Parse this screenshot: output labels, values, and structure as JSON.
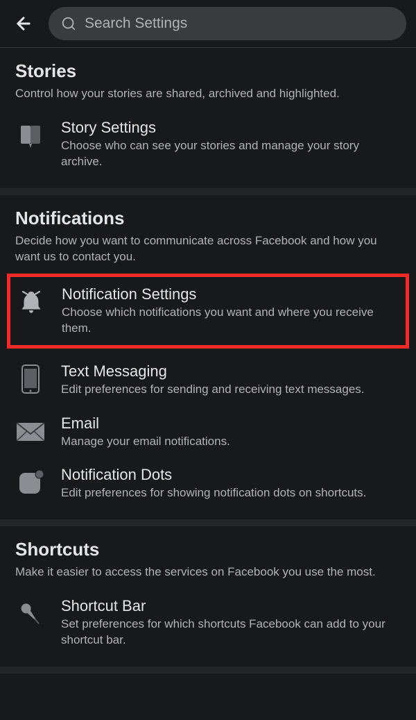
{
  "header": {
    "search_placeholder": "Search Settings"
  },
  "sections": {
    "stories": {
      "title": "Stories",
      "desc": "Control how your stories are shared, archived and highlighted.",
      "items": {
        "storySettings": {
          "title": "Story Settings",
          "desc": "Choose who can see your stories and manage your story archive."
        }
      }
    },
    "notifications": {
      "title": "Notifications",
      "desc": "Decide how you want to communicate across Facebook and how you want us to contact you.",
      "items": {
        "notificationSettings": {
          "title": "Notification Settings",
          "desc": "Choose which notifications you want and where you receive them."
        },
        "textMessaging": {
          "title": "Text Messaging",
          "desc": "Edit preferences for sending and receiving text messages."
        },
        "email": {
          "title": "Email",
          "desc": "Manage your email notifications."
        },
        "notificationDots": {
          "title": "Notification Dots",
          "desc": "Edit preferences for showing notification dots on shortcuts."
        }
      }
    },
    "shortcuts": {
      "title": "Shortcuts",
      "desc": "Make it easier to access the services on Facebook you use the most.",
      "items": {
        "shortcutBar": {
          "title": "Shortcut Bar",
          "desc": "Set preferences for which shortcuts Facebook can add to your shortcut bar."
        }
      }
    }
  }
}
